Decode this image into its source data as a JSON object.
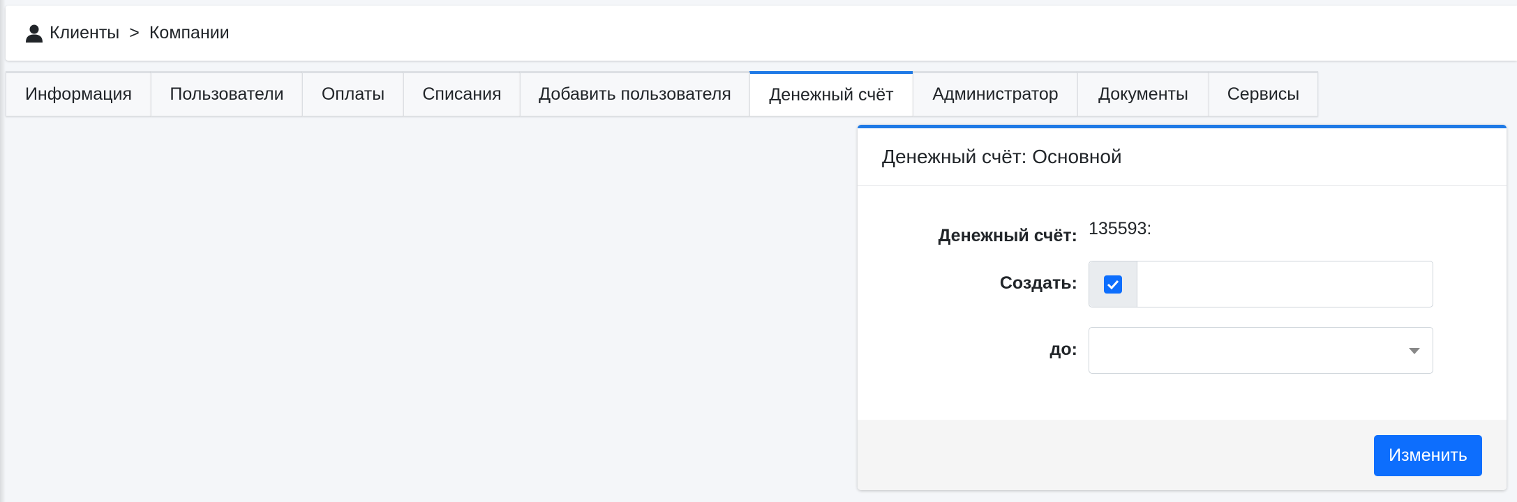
{
  "breadcrumb": {
    "icon": "user-icon",
    "items": [
      "Клиенты",
      "Компании"
    ],
    "separator": ">"
  },
  "tabs": [
    {
      "label": "Информация",
      "active": false
    },
    {
      "label": "Пользователи",
      "active": false
    },
    {
      "label": "Оплаты",
      "active": false
    },
    {
      "label": "Списания",
      "active": false
    },
    {
      "label": "Добавить пользователя",
      "active": false
    },
    {
      "label": "Денежный счёт",
      "active": true
    },
    {
      "label": "Администратор",
      "active": false
    },
    {
      "label": "Документы",
      "active": false
    },
    {
      "label": "Сервисы",
      "active": false
    }
  ],
  "card": {
    "title": "Денежный счёт: Основной",
    "fields": {
      "account_label": "Денежный счёт:",
      "account_value": "135593:",
      "create_label": "Создать:",
      "create_checked": true,
      "create_value": "",
      "until_label": "до:",
      "until_value": ""
    },
    "submit_label": "Изменить"
  },
  "colors": {
    "accent": "#1f7ae6",
    "button": "#0d6efd",
    "background": "#f4f6f9"
  }
}
